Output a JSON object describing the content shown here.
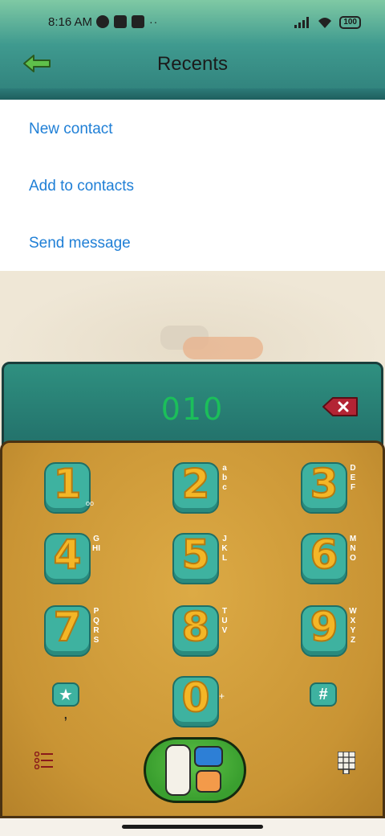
{
  "status_bar": {
    "time": "8:16 AM",
    "more": "··",
    "battery": "100"
  },
  "header": {
    "title": "Recents"
  },
  "menu": {
    "items": [
      {
        "label": "New contact"
      },
      {
        "label": "Add to contacts"
      },
      {
        "label": "Send message"
      }
    ]
  },
  "dialer": {
    "display_number": "010",
    "keys": [
      {
        "digit": "1",
        "letters": "",
        "sub": "oo"
      },
      {
        "digit": "2",
        "letters": "abc"
      },
      {
        "digit": "3",
        "letters": "DEF"
      },
      {
        "digit": "4",
        "letters": "GHI"
      },
      {
        "digit": "5",
        "letters": "JKL"
      },
      {
        "digit": "6",
        "letters": "MNO"
      },
      {
        "digit": "7",
        "letters": "PQRS"
      },
      {
        "digit": "8",
        "letters": "TUV"
      },
      {
        "digit": "9",
        "letters": "WXYZ"
      },
      {
        "digit": "0",
        "letters": "",
        "sub": "+"
      }
    ],
    "star": "★",
    "star_sub": ",",
    "hash": "#"
  },
  "colors": {
    "accent_link": "#1f7fd6",
    "display_number": "#1bbf5a",
    "key_base": "#3eb2a0",
    "key_digit": "#f4b626"
  }
}
